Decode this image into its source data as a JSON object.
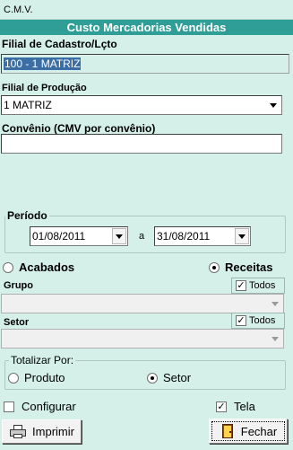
{
  "window": {
    "title": "C.M.V."
  },
  "banner": {
    "title": "Custo Mercadorias Vendidas"
  },
  "filial_cadastro": {
    "label": "Filial de Cadastro/Lçto",
    "value": "100 - 1 MATRIZ"
  },
  "filial_producao": {
    "label": "Filial de Produção",
    "value": "1 MATRIZ"
  },
  "convenio": {
    "label": "Convênio (CMV por convênio)",
    "value": ""
  },
  "periodo": {
    "label": "Período",
    "start": "01/08/2011",
    "separator": "a",
    "end": "31/08/2011"
  },
  "tipo": {
    "acabados": "Acabados",
    "receitas": "Receitas",
    "selected": "receitas"
  },
  "grupo": {
    "label": "Grupo",
    "todos": "Todos",
    "todos_checked": true,
    "value": ""
  },
  "setor": {
    "label": "Setor",
    "todos": "Todos",
    "todos_checked": true,
    "value": ""
  },
  "totalizar": {
    "label": "Totalizar Por:",
    "produto": "Produto",
    "setor": "Setor",
    "selected": "setor"
  },
  "options": {
    "configurar": "Configurar",
    "configurar_checked": false,
    "tela": "Tela",
    "tela_checked": true
  },
  "buttons": {
    "imprimir": "Imprimir",
    "fechar": "Fechar"
  }
}
